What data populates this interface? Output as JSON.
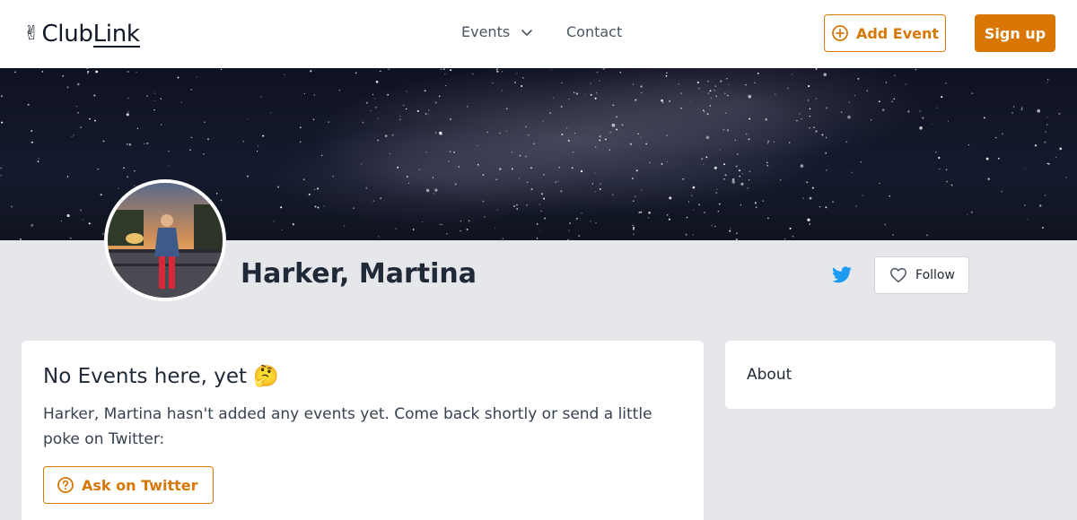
{
  "header": {
    "logo_emoji": "✌",
    "logo_word_a": "Club",
    "logo_word_b": "Link",
    "nav_events": "Events",
    "nav_contact": "Contact",
    "add_event": "Add Event",
    "sign_up": "Sign up"
  },
  "profile": {
    "name": "Harker, Martina",
    "follow": "Follow"
  },
  "events": {
    "title": "No Events here, yet 🤔",
    "description": "Harker, Martina hasn't added any events yet. Come back shortly or send a little poke on Twitter:",
    "ask_button": "Ask on Twitter"
  },
  "about": {
    "title": "About"
  },
  "colors": {
    "accent": "#d97706",
    "twitter": "#1d9bf0",
    "background": "#e5e7eb"
  },
  "icons": [
    "chevron-down-icon",
    "plus-circle-icon",
    "twitter-icon",
    "heart-icon",
    "question-circle-icon"
  ]
}
